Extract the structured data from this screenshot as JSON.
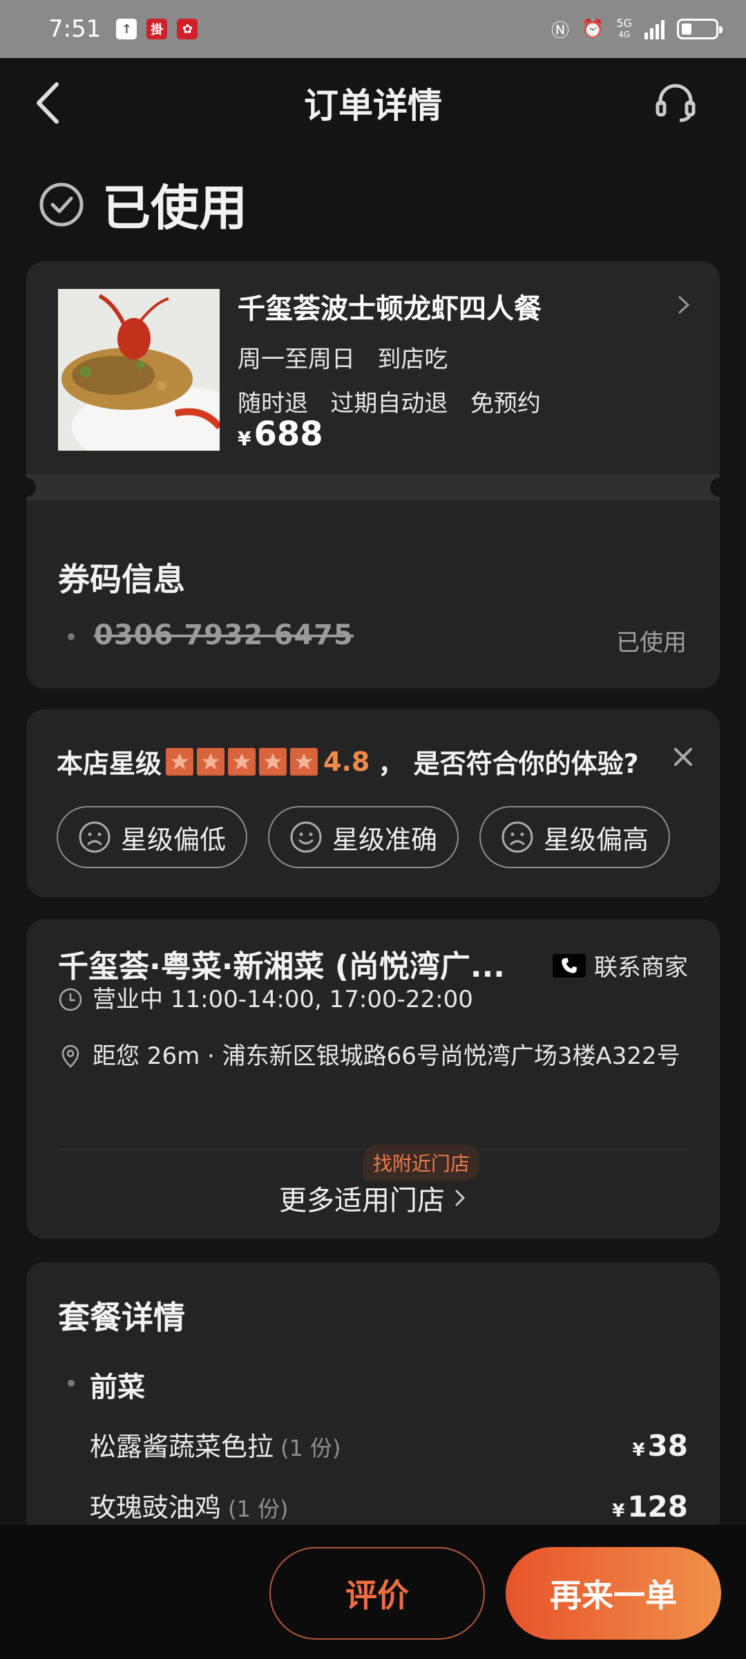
{
  "status_bar": {
    "time": "7:51",
    "network": "5G",
    "network_sub": "4G"
  },
  "nav": {
    "title": "订单详情"
  },
  "order_status": "已使用",
  "product": {
    "name": "千玺荟波士顿龙虾四人餐",
    "line1": "周一至周日   到店吃",
    "line2": "随时退   过期自动退   免预约",
    "currency": "¥",
    "price": "688"
  },
  "coupon": {
    "title": "券码信息",
    "code": "0306 7932 6475",
    "status": "已使用"
  },
  "rating": {
    "label": "本店星级",
    "stars": 5,
    "score": "4.8",
    "question": "，  是否符合你的体验?",
    "buttons": [
      "星级偏低",
      "星级准确",
      "星级偏高"
    ],
    "accent_color": "#d9633a"
  },
  "store": {
    "name": "千玺荟·粤菜·新湘菜 (尚悦湾广...",
    "contact_label": "联系商家",
    "hours": "营业中 11:00-14:00, 17:00-22:00",
    "address": "距您 26m · 浦东新区银城路66号尚悦湾广场3楼A322号",
    "nearby_tag": "找附近门店",
    "more_stores": "更多适用门店"
  },
  "package": {
    "title": "套餐详情",
    "category": "前菜",
    "dishes": [
      {
        "name": "松露酱蔬菜色拉",
        "qty": "(1 份)",
        "currency": "¥",
        "price": "38"
      },
      {
        "name": "玫瑰豉油鸡",
        "qty": "(1 份)",
        "currency": "¥",
        "price": "128"
      }
    ]
  },
  "actions": {
    "review": "评价",
    "reorder": "再来一单"
  }
}
